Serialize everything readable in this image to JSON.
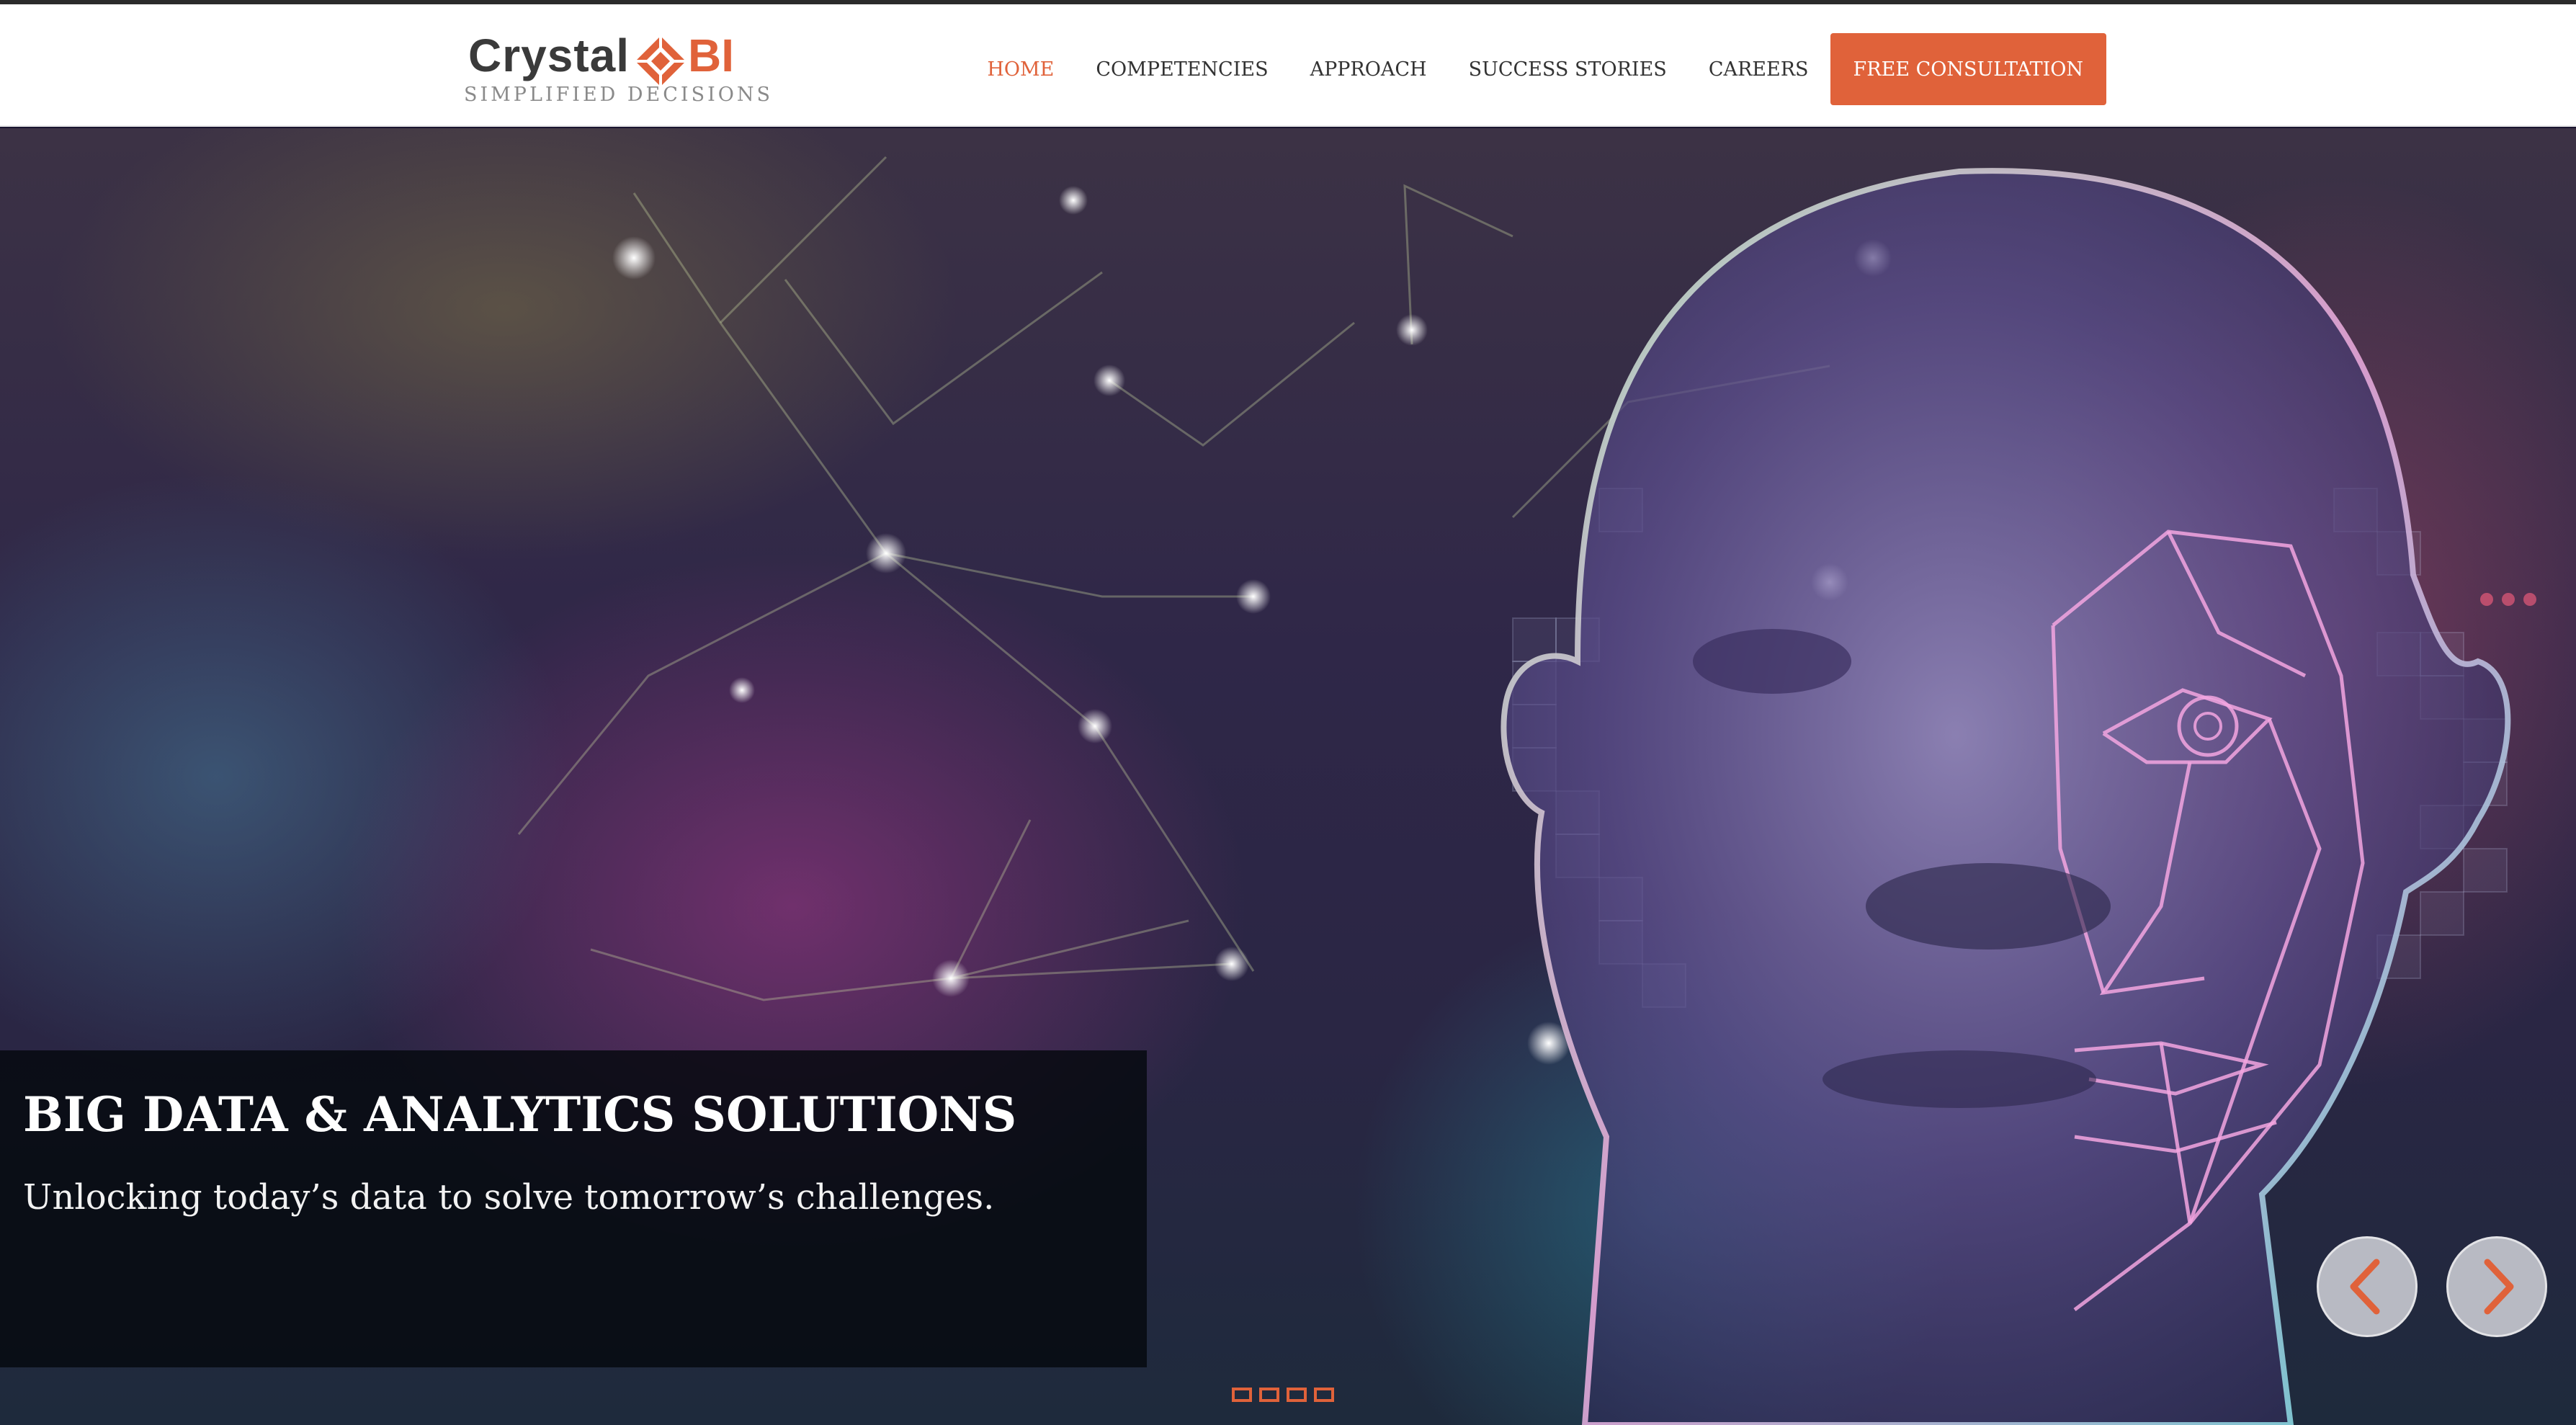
{
  "brand": {
    "name": "Crystal",
    "suffix": "BI",
    "tagline": "SIMPLIFIED DECISIONS",
    "logo_icon": "diamond-target-icon",
    "accent_color": "#e0623a"
  },
  "nav": {
    "items": [
      {
        "label": "HOME",
        "active": true
      },
      {
        "label": "COMPETENCIES",
        "active": false
      },
      {
        "label": "APPROACH",
        "active": false
      },
      {
        "label": "SUCCESS STORIES",
        "active": false
      },
      {
        "label": "CAREERS",
        "active": false
      }
    ],
    "cta_label": "FREE CONSULTATION"
  },
  "hero": {
    "title": "BIG DATA & ANALYTICS SOLUTIONS",
    "subtitle": "Unlocking today’s data to solve tomorrow’s challenges.",
    "image": "ai-face-network-illustration",
    "slide_count": 4,
    "controls": {
      "prev_icon": "chevron-left-icon",
      "next_icon": "chevron-right-icon"
    }
  }
}
